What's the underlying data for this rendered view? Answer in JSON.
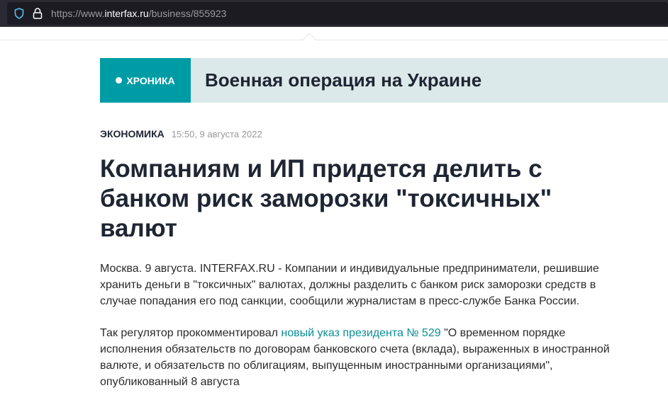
{
  "browser": {
    "url_prefix": "https://www.",
    "url_domain": "interfax.ru",
    "url_path": "/business/855923"
  },
  "banner": {
    "label": "ХРОНИКА",
    "title": "Военная операция на Украине"
  },
  "article": {
    "category": "ЭКОНОМИКА",
    "date": "15:50, 9 августа 2022",
    "headline": "Компаниям и ИП придется делить с банком риск заморозки \"токсичных\" валют",
    "p1": "Москва. 9 августа. INTERFAX.RU - Компании и индивидуальные предприниматели, решившие хранить деньги в \"токсичных\" валютах, должны разделить с банком риск заморозки средств в случае попадания его под санкции, сообщили журналистам в пресс-службе Банка России.",
    "p2_before": "Так регулятор прокомментировал ",
    "p2_link": "новый указ президента № 529",
    "p2_after": " \"О временном порядке исполнения обязательств по договорам банковского счета (вклада), выраженных в иностранной валюте, и обязательств по облигациям, выпущенным иностранными организациями\", опубликованный 8 августа"
  }
}
